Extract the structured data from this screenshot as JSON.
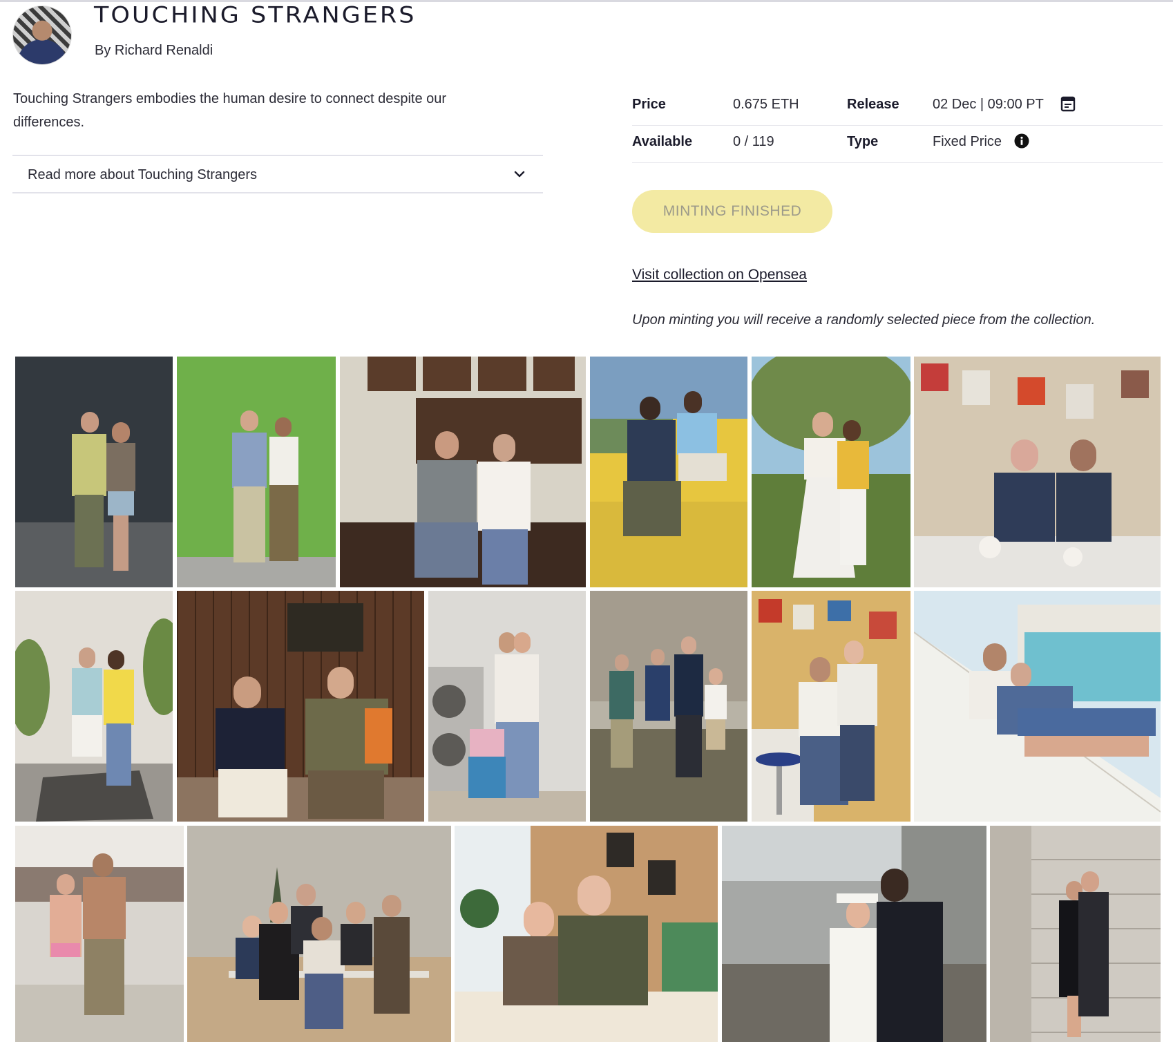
{
  "header": {
    "title": "TOUCHING STRANGERS",
    "byline": "By Richard Renaldi",
    "avatar_icon": "artist-avatar"
  },
  "description": {
    "text": "Touching Strangers embodies the human desire to connect despite our differences.",
    "read_more": "Read more about Touching Strangers"
  },
  "info": {
    "price_label": "Price",
    "price_value": "0.675 ETH",
    "release_label": "Release",
    "release_value": "02 Dec | 09:00 PT",
    "available_label": "Available",
    "available_value": "0 / 119",
    "type_label": "Type",
    "type_value": "Fixed Price"
  },
  "actions": {
    "mint_button": "MINTING FINISHED",
    "opensea_link": "Visit collection on Opensea",
    "mint_note": "Upon minting you will receive a randomly selected piece from the collection."
  },
  "colors": {
    "mint_button_bg": "#f3eaa3",
    "text_primary": "#1b1b2b"
  },
  "gallery": {
    "photo_count": 17
  }
}
